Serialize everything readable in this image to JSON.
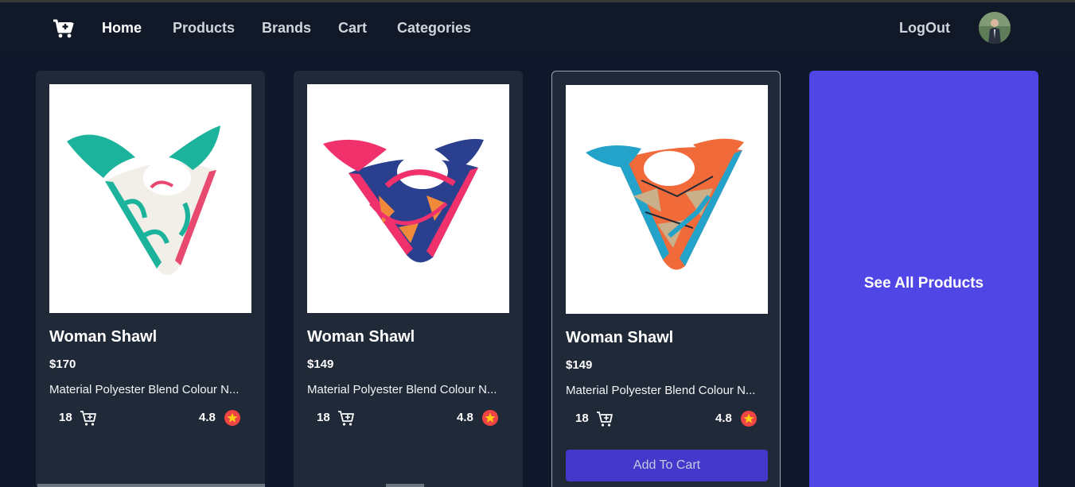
{
  "nav": {
    "logo_icon": "cart-plus-icon",
    "links": [
      {
        "label": "Home",
        "active": true
      },
      {
        "label": "Products",
        "active": false
      },
      {
        "label": "Brands",
        "active": false
      },
      {
        "label": "Cart",
        "active": false
      },
      {
        "label": "Categories",
        "active": false
      }
    ],
    "logout": "LogOut",
    "avatar_icon": "user-avatar"
  },
  "products": [
    {
      "title": "Woman Shawl",
      "price": "$170",
      "description": "Material Polyester Blend Colour N...",
      "count": "18",
      "rating": "4.8",
      "cart_icon": "cart-icon",
      "rating_icon": "star-icon",
      "colors": [
        "#1bb39c",
        "#f2eee8",
        "#e84a6f"
      ]
    },
    {
      "title": "Woman Shawl",
      "price": "$149",
      "description": "Material Polyester Blend Colour N...",
      "count": "18",
      "rating": "4.8",
      "cart_icon": "cart-icon",
      "rating_icon": "star-icon",
      "colors": [
        "#2b3f8f",
        "#f0316c",
        "#f08a3a"
      ]
    },
    {
      "title": "Woman Shawl",
      "price": "$149",
      "description": "Material Polyester Blend Colour N...",
      "count": "18",
      "rating": "4.8",
      "cart_icon": "cart-icon",
      "rating_icon": "star-icon",
      "colors": [
        "#f06a3a",
        "#23a3c9",
        "#c9b08a"
      ],
      "add_to_cart": "Add To Cart"
    }
  ],
  "see_all": "See All Products",
  "colors": {
    "page_bg": "#0f172a",
    "nav_bg": "#111827",
    "card_bg": "#1f2937",
    "accent": "#4f46e5",
    "button": "#4338ca",
    "star": "#ef4444"
  }
}
